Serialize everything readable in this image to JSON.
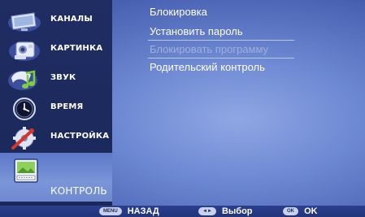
{
  "sidebar": {
    "items": [
      {
        "label": "КАНАЛЫ",
        "icon": "tv-icon"
      },
      {
        "label": "КАРТИНКА",
        "icon": "camera-icon"
      },
      {
        "label": "ЗВУК",
        "icon": "music-note-icon"
      },
      {
        "label": "ВРЕМЯ",
        "icon": "clock-icon"
      },
      {
        "label": "НАСТРОЙКА",
        "icon": "wrench-gear-icon"
      },
      {
        "label": "КОНТРОЛЬ",
        "icon": "parental-control-icon",
        "selected": true
      }
    ]
  },
  "menu": {
    "items": [
      {
        "label": "Блокировка",
        "enabled": true
      },
      {
        "label": "Установить пароль",
        "enabled": true
      },
      {
        "label": "Блокировать программу",
        "enabled": false
      },
      {
        "label": "Родительский контроль",
        "enabled": true
      }
    ]
  },
  "footer": {
    "back": {
      "key": "MENU",
      "label": "НАЗАД"
    },
    "select": {
      "key": "◄►",
      "label": "Выбор"
    },
    "ok": {
      "key": "OK",
      "label": "OK"
    }
  },
  "colors": {
    "background": "#6f8ad4",
    "sidebar": "#1f2d63",
    "selected": "#7a95d8",
    "text": "#ffffff",
    "disabled_text": "#9fb0dc"
  }
}
